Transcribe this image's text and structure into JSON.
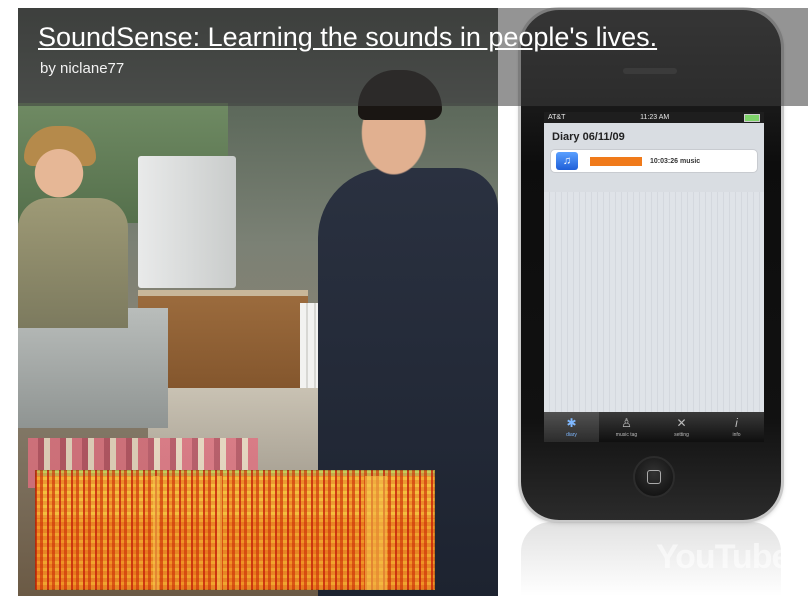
{
  "video": {
    "title": "SoundSense: Learning the sounds in people's lives.",
    "uploader": "by niclane77",
    "watermark": "YouTube"
  },
  "phone": {
    "status": {
      "carrier": "AT&T",
      "time": "11:23 AM"
    },
    "diary_title": "Diary 06/11/09",
    "entry": {
      "icon": "music-note-icon",
      "text": "10:03:26 music",
      "bar_color": "#f07a1a"
    },
    "tabs": [
      {
        "label": "diary",
        "icon": "gear-icon"
      },
      {
        "label": "music tag",
        "icon": "person-icon"
      },
      {
        "label": "setting",
        "icon": "tools-icon"
      },
      {
        "label": "info",
        "icon": "info-icon"
      }
    ]
  }
}
